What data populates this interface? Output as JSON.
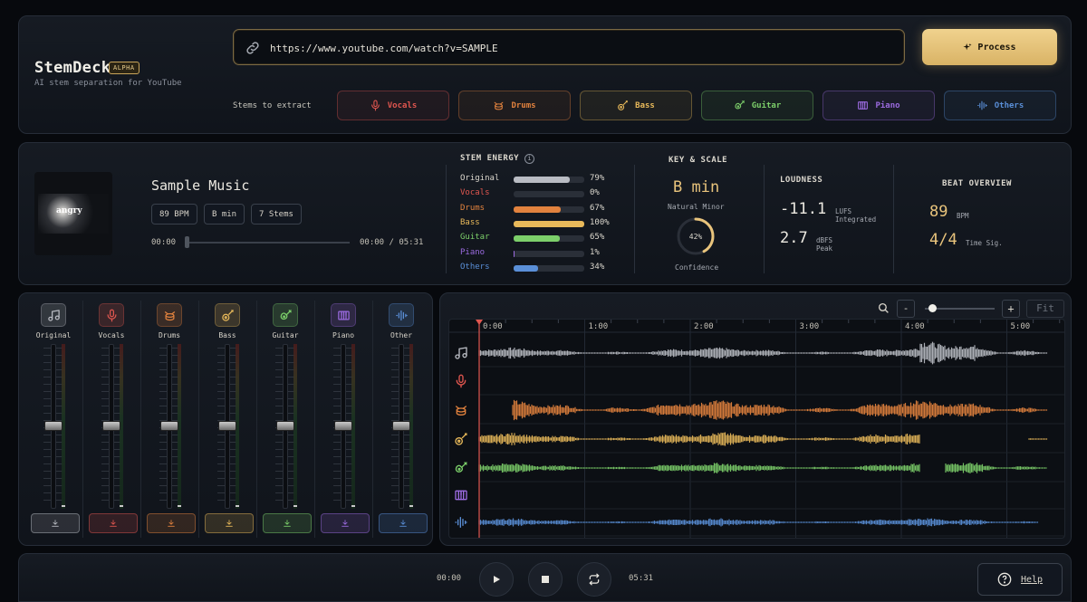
{
  "header": {
    "brand": "StemDeck",
    "badge": "ALPHA",
    "tagline": "AI stem separation for YouTube",
    "url_value": "https://www.youtube.com/watch?v=SAMPLE",
    "process_label": "Process",
    "stems_label": "Stems to extract",
    "stems": [
      {
        "label": "Vocals",
        "icon": "mic-icon",
        "color": "#e0564f"
      },
      {
        "label": "Drums",
        "icon": "drum-icon",
        "color": "#e2823e"
      },
      {
        "label": "Bass",
        "icon": "bass-guitar-icon",
        "color": "#e8b95a"
      },
      {
        "label": "Guitar",
        "icon": "guitar-icon",
        "color": "#7ccf6a"
      },
      {
        "label": "Piano",
        "icon": "piano-icon",
        "color": "#9b6be0"
      },
      {
        "label": "Others",
        "icon": "waveform-icon",
        "color": "#5a8fd8"
      }
    ]
  },
  "track": {
    "cover_text": "angry",
    "title": "Sample Music",
    "bpm_pill": "89 BPM",
    "key_pill": "B min",
    "stems_pill": "7 Stems",
    "time_start": "00:00",
    "time_total": "00:00 / 05:31",
    "progress": 0
  },
  "energy": {
    "heading": "STEM ENERGY",
    "rows": [
      {
        "name": "Original",
        "pct": "79%",
        "value": 0.79,
        "color": "#b9bcc3"
      },
      {
        "name": "Vocals",
        "pct": "0%",
        "value": 0.0,
        "color": "#e0564f"
      },
      {
        "name": "Drums",
        "pct": "67%",
        "value": 0.67,
        "color": "#e2823e"
      },
      {
        "name": "Bass",
        "pct": "100%",
        "value": 1.0,
        "color": "#e8b95a"
      },
      {
        "name": "Guitar",
        "pct": "65%",
        "value": 0.65,
        "color": "#7ccf6a"
      },
      {
        "name": "Piano",
        "pct": "1%",
        "value": 0.01,
        "color": "#9b6be0"
      },
      {
        "name": "Others",
        "pct": "34%",
        "value": 0.34,
        "color": "#5a8fd8"
      }
    ]
  },
  "key": {
    "heading": "KEY & SCALE",
    "value": "B min",
    "scale": "Natural Minor",
    "confidence": "42%",
    "confidence_value": 0.42,
    "confidence_label": "Confidence"
  },
  "loudness": {
    "heading": "LOUDNESS",
    "lufs": "-11.1",
    "lufs_unit_1": "LUFS",
    "lufs_unit_2": "Integrated",
    "peak": "2.7",
    "peak_unit_1": "dBFS",
    "peak_unit_2": "Peak"
  },
  "beat": {
    "heading": "BEAT OVERVIEW",
    "bpm": "89",
    "bpm_unit": "BPM",
    "sig": "4/4",
    "sig_unit": "Time Sig."
  },
  "mixer": {
    "channels": [
      {
        "name": "Original",
        "icon": "music-note-icon",
        "color": "#b9bcc3",
        "level": 0.5
      },
      {
        "name": "Vocals",
        "icon": "mic-icon",
        "color": "#e0564f",
        "level": 0.5
      },
      {
        "name": "Drums",
        "icon": "drum-icon",
        "color": "#e2823e",
        "level": 0.5
      },
      {
        "name": "Bass",
        "icon": "bass-guitar-icon",
        "color": "#e8b95a",
        "level": 0.5
      },
      {
        "name": "Guitar",
        "icon": "guitar-icon",
        "color": "#7ccf6a",
        "level": 0.5
      },
      {
        "name": "Piano",
        "icon": "piano-icon",
        "color": "#9b6be0",
        "level": 0.5
      },
      {
        "name": "Other",
        "icon": "waveform-icon",
        "color": "#5a8fd8",
        "level": 0.5
      }
    ]
  },
  "waveform": {
    "zoom_out": "-",
    "zoom_in": "+",
    "fit": "Fit",
    "zoom_level": 0.05,
    "time_labels": [
      "0:00",
      "1:00",
      "2:00",
      "3:00",
      "4:00",
      "5:00"
    ]
  },
  "transport": {
    "time_current": "00:00",
    "time_total": "05:31",
    "help": "Help"
  }
}
